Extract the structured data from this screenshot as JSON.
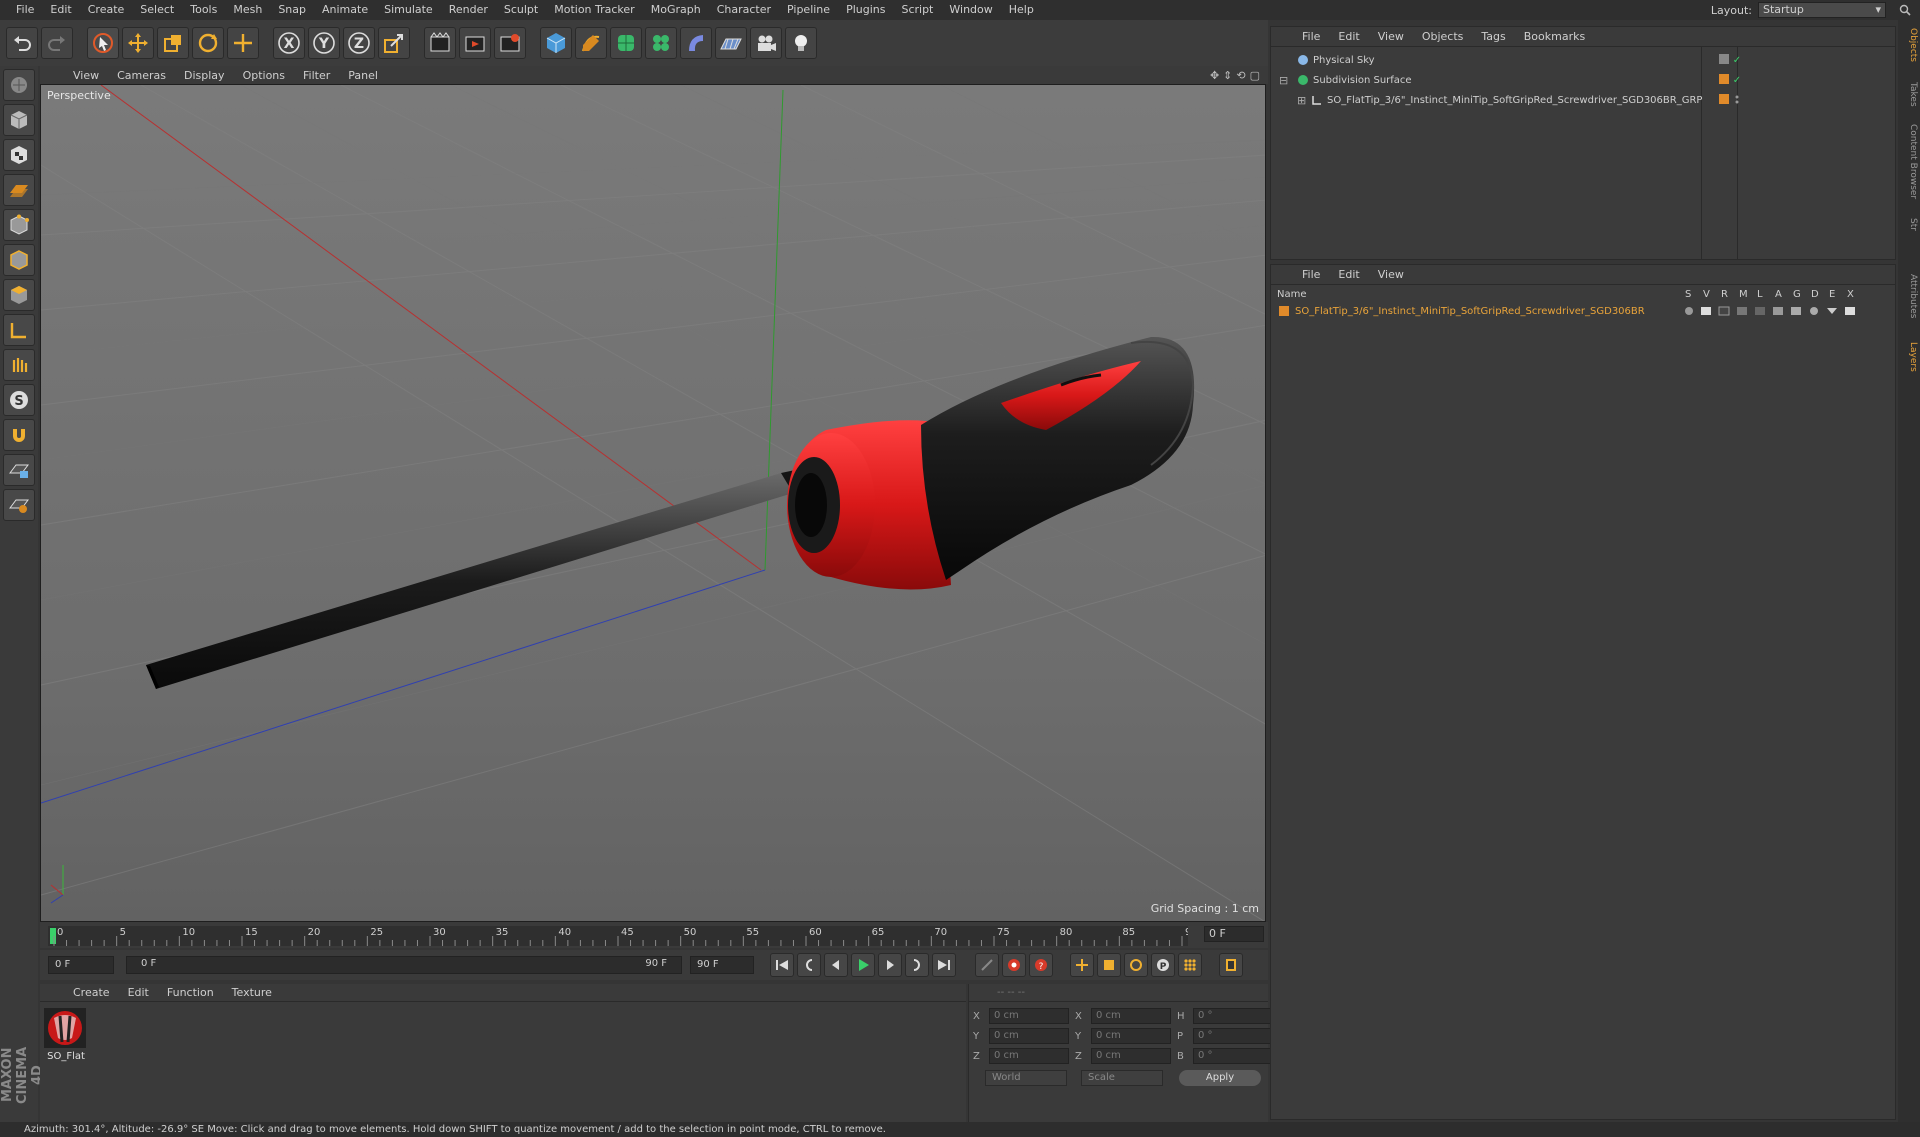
{
  "menu": [
    "File",
    "Edit",
    "Create",
    "Select",
    "Tools",
    "Mesh",
    "Snap",
    "Animate",
    "Simulate",
    "Render",
    "Sculpt",
    "Motion Tracker",
    "MoGraph",
    "Character",
    "Pipeline",
    "Plugins",
    "Script",
    "Window",
    "Help"
  ],
  "layout": {
    "label": "Layout:",
    "value": "Startup"
  },
  "viewport": {
    "menu": [
      "View",
      "Cameras",
      "Display",
      "Options",
      "Filter",
      "Panel"
    ],
    "label": "Perspective",
    "grid_spacing": "Grid Spacing : 1 cm"
  },
  "timeline": {
    "ticks": [
      "0",
      "5",
      "10",
      "15",
      "20",
      "25",
      "30",
      "35",
      "40",
      "45",
      "50",
      "55",
      "60",
      "65",
      "70",
      "75",
      "80",
      "85",
      "90"
    ],
    "current_frame": "0 F",
    "start_field": "0 F",
    "range_start": "0 F",
    "range_end": "90 F",
    "end_field": "90 F"
  },
  "material_manager": {
    "menu": [
      "Create",
      "Edit",
      "Function",
      "Texture"
    ],
    "material_label": "SO_Flat"
  },
  "coordinates": {
    "pos": {
      "x": "0 cm",
      "y": "0 cm",
      "z": "0 cm"
    },
    "size": {
      "x": "0 cm",
      "y": "0 cm",
      "z": "0 cm"
    },
    "rot": {
      "h": "0 °",
      "p": "0 °",
      "b": "0 °"
    },
    "labels": {
      "x": "X",
      "y": "Y",
      "z": "Z",
      "h": "H",
      "p": "P",
      "b": "B"
    },
    "mode": "World",
    "type": "Scale",
    "apply": "Apply"
  },
  "object_manager": {
    "menu": [
      "File",
      "Edit",
      "View",
      "Objects",
      "Tags",
      "Bookmarks"
    ],
    "objects": [
      {
        "name": "Physical Sky"
      },
      {
        "name": "Subdivision Surface"
      },
      {
        "name": "SO_FlatTip_3/6\"_Instinct_MiniTip_SoftGripRed_Screwdriver_SGD306BR_GRP"
      }
    ]
  },
  "layer_manager": {
    "menu": [
      "File",
      "Edit",
      "View"
    ],
    "name_header": "Name",
    "columns": [
      "S",
      "V",
      "R",
      "M",
      "L",
      "A",
      "G",
      "D",
      "E",
      "X"
    ],
    "layer": "SO_FlatTip_3/6\"_Instinct_MiniTip_SoftGripRed_Screwdriver_SGD306BR"
  },
  "side_tabs": [
    "Objects",
    "Takes",
    "Content Browser",
    "Str",
    "Attributes",
    "Layers"
  ],
  "status": "Azimuth: 301.4°, Altitude: -26.9°  SE     Move: Click and drag to move elements. Hold down SHIFT to quantize movement / add to the selection in point mode, CTRL to remove.",
  "brand": "MAXON CINEMA 4D",
  "colors": {
    "accent": "#e8a33a",
    "red": "#d81818",
    "active_layer": "#e08a2a"
  }
}
